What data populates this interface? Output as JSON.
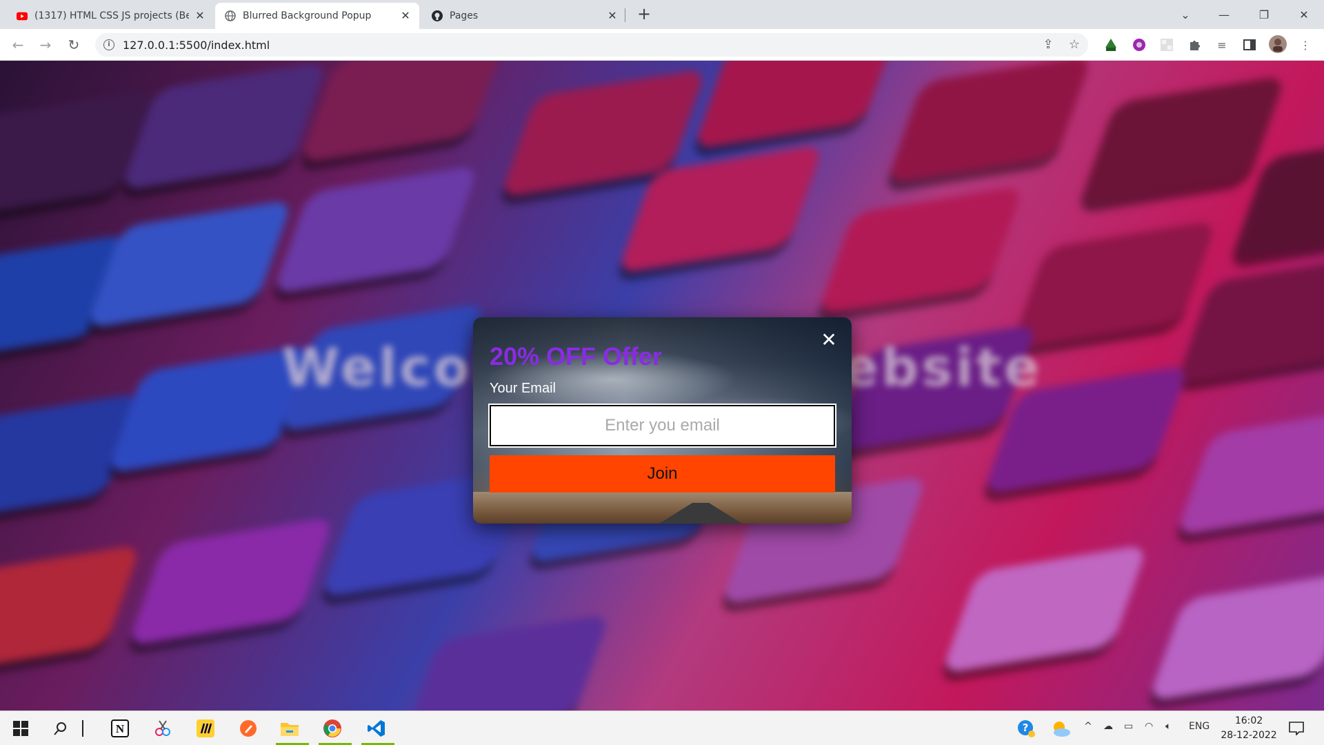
{
  "browser": {
    "tabs": [
      {
        "title": "(1317) HTML CSS JS projects (Bec",
        "favicon": "youtube-icon"
      },
      {
        "title": "Blurred Background Popup",
        "favicon": "globe-icon"
      },
      {
        "title": "Pages",
        "favicon": "github-icon"
      }
    ],
    "url": "127.0.0.1:5500/index.html"
  },
  "page": {
    "background_heading": "Welcome to my website",
    "popup": {
      "title": "20% OFF Offer",
      "email_label": "Your Email",
      "email_placeholder": "Enter you email",
      "join_label": "Join",
      "close_glyph": "✕"
    }
  },
  "taskbar": {
    "language": "ENG",
    "time": "16:02",
    "date": "28-12-2022"
  },
  "colors": {
    "title": "#8a2be2",
    "join_button": "#ff4500"
  }
}
